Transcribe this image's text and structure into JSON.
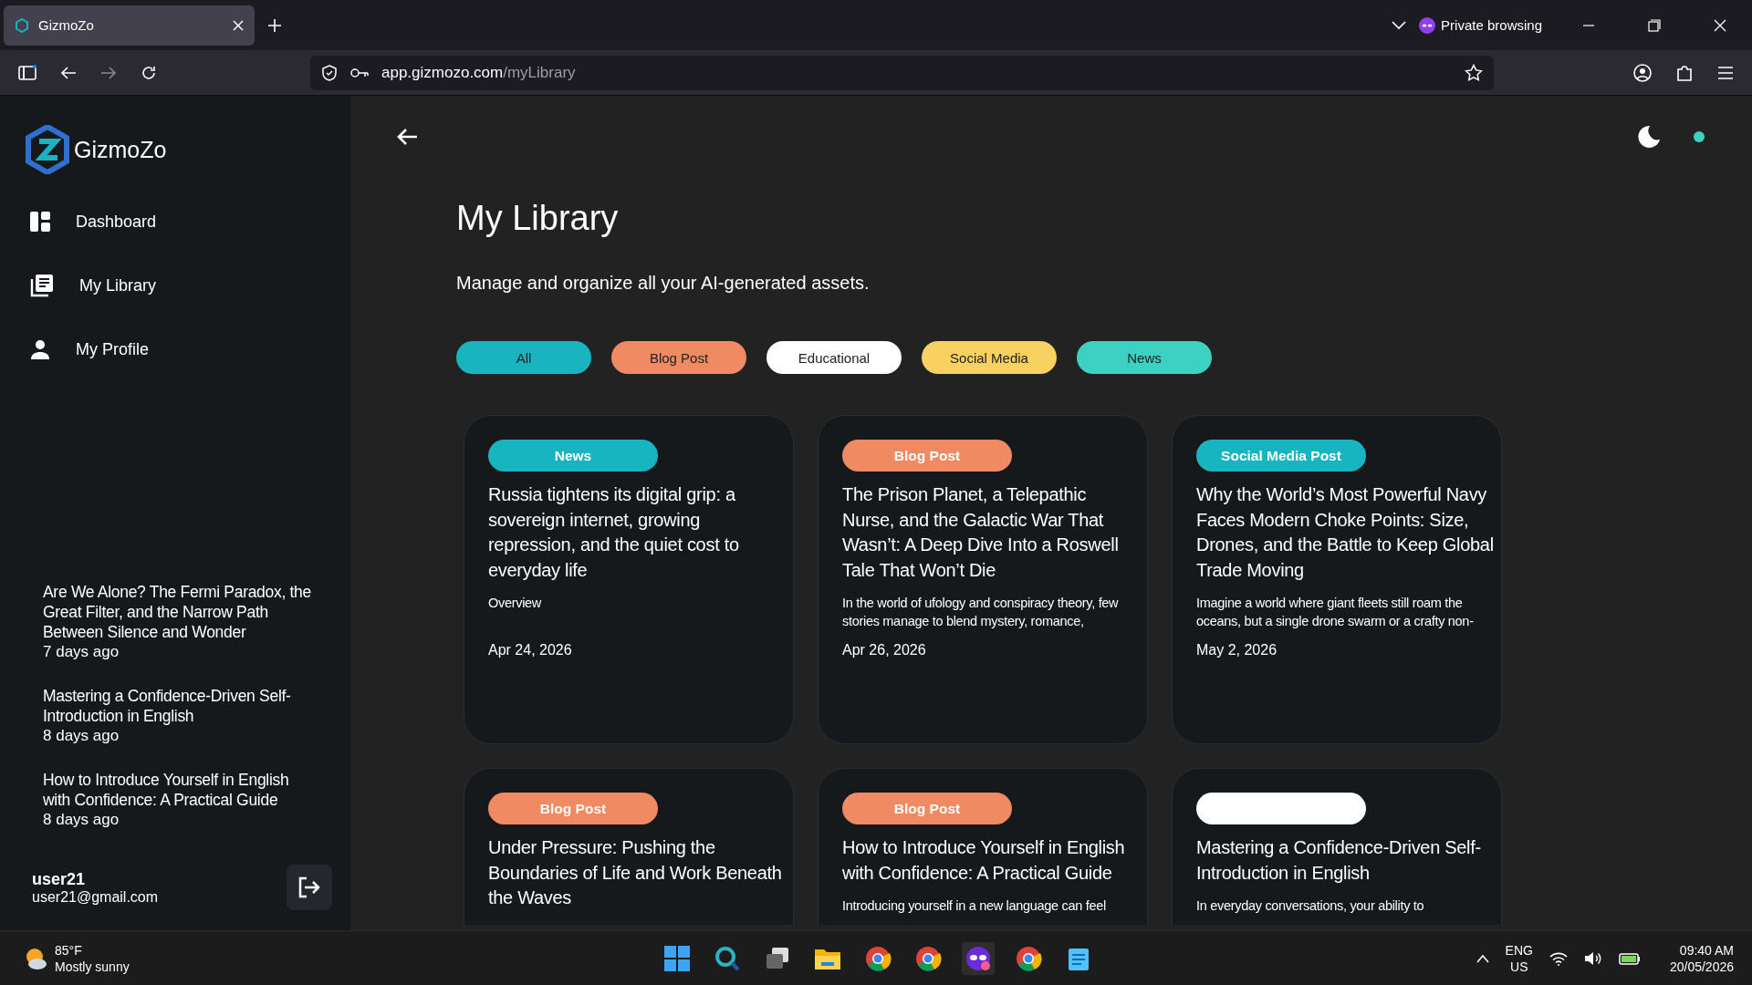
{
  "browser": {
    "tab_title": "GizmoZo",
    "url_host": "app.gizmozo.com",
    "url_path": "/myLibrary",
    "private_label": "Private browsing"
  },
  "sidebar": {
    "brand": "GizmoZo",
    "nav": [
      {
        "label": "Dashboard",
        "kind": "dashboard"
      },
      {
        "label": "My Library",
        "kind": "library"
      },
      {
        "label": "My Profile",
        "kind": "profile"
      }
    ],
    "recent": [
      {
        "title": "Are We Alone? The Fermi Paradox, the Great Filter, and the Narrow Path Between Silence and Wonder",
        "time": "7 days ago"
      },
      {
        "title": "Mastering a Confidence-Driven Self-Introduction in English",
        "time": "8 days ago"
      },
      {
        "title": "How to Introduce Yourself in English with Confidence: A Practical Guide",
        "time": "8 days ago"
      }
    ],
    "user": {
      "name": "user21",
      "email": "user21@gmail.com"
    }
  },
  "page": {
    "title": "My Library",
    "subtitle": "Manage and organize all your AI-generated assets.",
    "filters": [
      {
        "label": "All",
        "color": "#1ab3c0"
      },
      {
        "label": "Blog Post",
        "color": "#ef8a62"
      },
      {
        "label": "Educational",
        "color": "#ffffff"
      },
      {
        "label": "Social Media",
        "color": "#f9d160"
      },
      {
        "label": "News",
        "color": "#3dd1c2"
      }
    ]
  },
  "cards": [
    {
      "tag": "News",
      "color": "#17b5c0",
      "title": "Russia tightens its digital grip: a sovereign internet, growing repression, and the quiet cost to everyday life",
      "summary": "Overview",
      "date": "Apr 24, 2026"
    },
    {
      "tag": "Blog Post",
      "color": "#ef8a62",
      "title": "The Prison Planet, a Telepathic Nurse, and the Galactic War That Wasn’t: A Deep Dive Into a Roswell Tale That Won’t Die",
      "summary": "In the world of ufology and conspiracy theory, few stories manage to blend mystery, romance,",
      "date": "Apr 26, 2026"
    },
    {
      "tag": "Social Media Post",
      "color": "#17b5c0",
      "title": "Why the World’s Most Powerful Navy Faces Modern Choke Points: Size, Drones, and the Battle to Keep Global Trade Moving",
      "summary": "Imagine a world where giant fleets still roam the oceans, but a single drone swarm or a crafty non-",
      "date": "May 2, 2026"
    },
    {
      "tag": "Blog Post",
      "color": "#ef8a62",
      "title": "Under Pressure: Pushing the Boundaries of Life and Work Beneath the Waves"
    },
    {
      "tag": "Blog Post",
      "color": "#ef8a62",
      "title": "How to Introduce Yourself in English with Confidence: A Practical Guide",
      "summary": "Introducing yourself in a new language can feel"
    },
    {
      "color": "#ffffff",
      "title": "Mastering a Confidence-Driven Self-Introduction in English",
      "summary": "In everyday conversations, your ability to"
    }
  ],
  "taskbar": {
    "weather_temp": "85°F",
    "weather_text": "Mostly sunny",
    "lang": "ENG",
    "region": "US",
    "time": "09:40 AM",
    "date": "20/05/2026"
  }
}
